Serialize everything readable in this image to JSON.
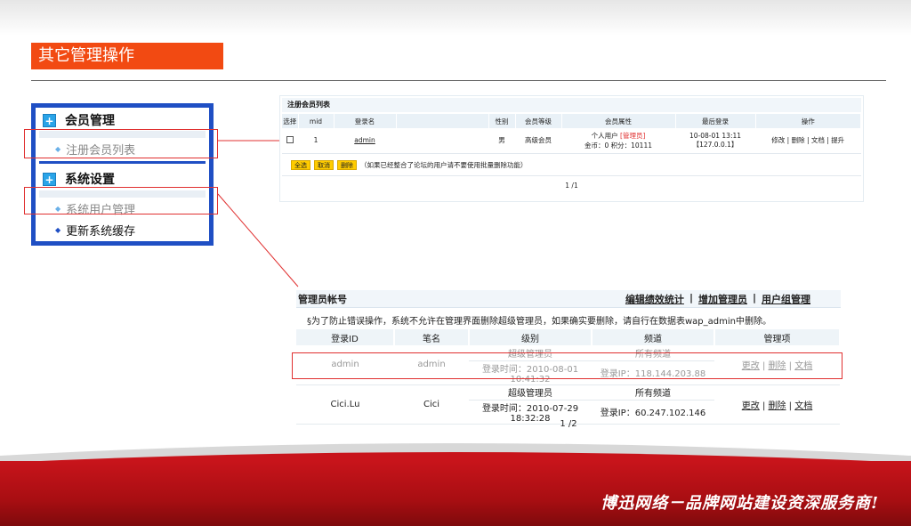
{
  "page": {
    "title": "其它管理操作"
  },
  "sidebar": {
    "groups": [
      {
        "header": "会员管理",
        "items": [
          "注册会员列表"
        ]
      },
      {
        "header": "系统设置",
        "items": [
          "系统用户管理",
          "更新系统缓存"
        ]
      }
    ]
  },
  "member_list": {
    "title": "注册会员列表",
    "columns": [
      "选择",
      "mid",
      "登录名",
      "",
      "性别",
      "会员等级",
      "会员属性",
      "最后登录",
      "操作"
    ],
    "row": {
      "mid": "1",
      "login": "admin",
      "gender": "男",
      "level": "高级会员",
      "attr_line1": "个人用户",
      "attr_tag": "[管理员]",
      "attr_line2": "金币：0 积分：10111",
      "last_login_date": "10-08-01 13:11",
      "last_login_ip": "【127.0.0.1】",
      "ops": [
        "修改",
        "删除",
        "文档",
        "提升"
      ]
    },
    "buttons": [
      "全选",
      "取消",
      "删除"
    ],
    "hint": "（如果已经整合了论坛的用户请不要使用批量删除功能）",
    "pagination": "1 /1"
  },
  "admin_panel": {
    "title": "管理员帐号",
    "links": [
      "编辑绩效统计",
      "增加管理员",
      "用户组管理"
    ],
    "notice": "§为了防止错误操作，系统不允许在管理界面删除超级管理员，如果确实要删除，请自行在数据表wap_admin中删除。",
    "columns": [
      "登录ID",
      "笔名",
      "级别",
      "频道",
      "管理项"
    ],
    "rows": [
      {
        "login_id": "admin",
        "pen_name": "admin",
        "level": "超级管理员",
        "login_time": "登录时间：2010-08-01 10:41:32",
        "channel": "所有频道",
        "login_ip": "登录IP：118.144.203.88",
        "ops": [
          "更改",
          "删除",
          "文档"
        ]
      },
      {
        "login_id": "Cici.Lu",
        "pen_name": "Cici",
        "level": "超级管理员",
        "login_time": "登录时间：2010-07-29 18:32:28",
        "channel": "所有频道",
        "login_ip": "登录IP：60.247.102.146",
        "ops": [
          "更改",
          "删除",
          "文档"
        ]
      }
    ],
    "pagination": "1 /2"
  },
  "footer": {
    "slogan": "博迅网络－品牌网站建设资深服务商!"
  },
  "colors": {
    "accent": "#f24a12",
    "sidebar_border": "#1f4fc4",
    "footer_red": "#c8141b",
    "highlight": "#e03030"
  }
}
